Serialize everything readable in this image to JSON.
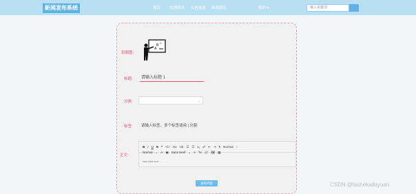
{
  "header": {
    "logo": "新闻发布系统",
    "nav": [
      "首页",
      "交通资讯",
      "公告信息",
      "新闻资讯"
    ],
    "my": "我的",
    "my_arrow": "▾",
    "search_placeholder": "输入关键词"
  },
  "form": {
    "cover_label": "封面图:",
    "title_label": "标题:",
    "title_value": "请输入标题 1",
    "category_label": "分类:",
    "category_value": "",
    "tags_label": "标签:",
    "tags_value": "请输入标签，多个标签请用 | 分割",
    "content_label": "正文:",
    "content_placeholder": "Insert text here ...",
    "submit_label": "发布内容"
  },
  "toolbar": {
    "row1": [
      "B",
      "I",
      "U",
      "S",
      "❝",
      "</>",
      "H1",
      "H2",
      "☰",
      "☰",
      "x₂",
      "x²",
      "⇤",
      "⇥",
      "¶",
      "Normal",
      "÷"
    ],
    "row2": [
      "Normal",
      "⌄",
      "A",
      "▣",
      "Sans Serif",
      "⌄",
      "≡",
      "Tx",
      "🔗",
      "🖼",
      "▦"
    ]
  },
  "watermark": "CSDN @bishekaifayuan",
  "colors": {
    "accent": "#e05570",
    "header": "#b9dff3",
    "button": "#6bbbec"
  }
}
